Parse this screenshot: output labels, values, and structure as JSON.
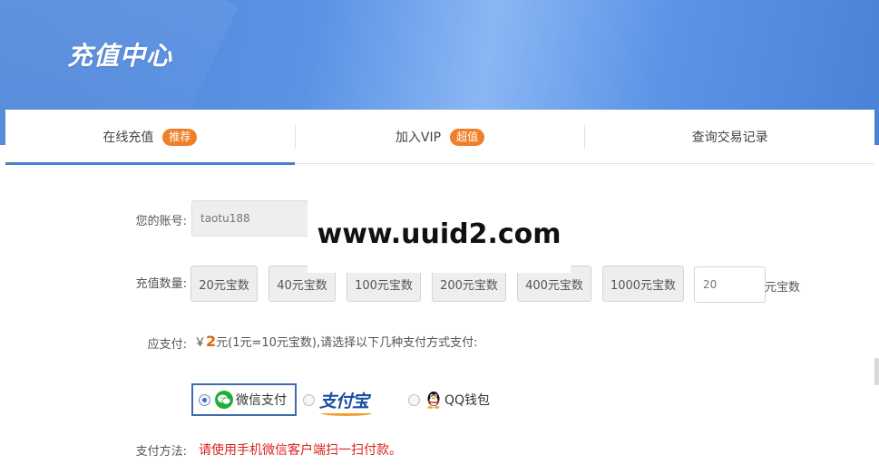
{
  "header": {
    "title": "充值中心"
  },
  "tabs": [
    {
      "label": "在线充值",
      "badge": "推荐",
      "active": true
    },
    {
      "label": "加入VIP",
      "badge": "超值",
      "active": false
    },
    {
      "label": "查询交易记录",
      "badge": "",
      "active": false
    }
  ],
  "form": {
    "account_label": "您的账号:",
    "account_value": "taotu188",
    "amount_label": "充值数量:",
    "amount_options": [
      "20元宝数",
      "40元宝数",
      "100元宝数",
      "200元宝数",
      "400元宝数",
      "1000元宝数"
    ],
    "custom_amount_value": "20",
    "custom_amount_unit": "元宝数",
    "pay_label": "应支付:",
    "currency_symbol": "￥",
    "pay_amount": "2",
    "pay_suffix": "元(1元=10元宝数),请选择以下几种支付方式支付:",
    "payment_methods": [
      {
        "name": "微信支付",
        "icon": "wechat-icon",
        "selected": true
      },
      {
        "name": "支付宝",
        "icon": "alipay-logo",
        "selected": false
      },
      {
        "name": "QQ钱包",
        "icon": "qq-penguin-icon",
        "selected": false
      }
    ],
    "method_label": "支付方法:",
    "method_notice": "请使用手机微信客户端扫一扫付款。"
  },
  "watermark": "www.uuid2.com",
  "colors": {
    "banner": "#5a92e4",
    "accent_orange": "#f07f2a",
    "tab_active": "#4a7fc9",
    "notice_red": "#d8231c",
    "wechat_green": "#22ad38"
  }
}
